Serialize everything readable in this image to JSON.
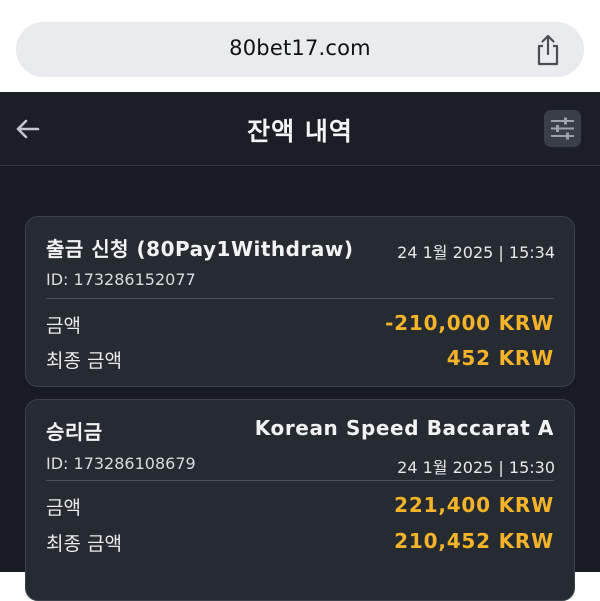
{
  "browser": {
    "url": "80bet17.com"
  },
  "header": {
    "title": "잔액 내역"
  },
  "transactions": [
    {
      "title": "출금 신청 (80Pay1Withdraw)",
      "game": "",
      "id_line": "ID: 173286152077",
      "datetime": "24 1월 2025 | 15:34",
      "amount_label": "금액",
      "amount": "-210,000 KRW",
      "final_label": "최종 금액",
      "final_amount": "452 KRW"
    },
    {
      "title": "승리금",
      "game": "Korean Speed Baccarat A",
      "id_line": "ID: 173286108679",
      "datetime": "24 1월 2025 | 15:30",
      "amount_label": "금액",
      "amount": "221,400 KRW",
      "final_label": "최종 금액",
      "final_amount": "210,452 KRW"
    }
  ],
  "colors": {
    "accent": "#f5b32a",
    "background": "#181b21",
    "card": "#262a31"
  },
  "icons": {
    "share": "share-icon",
    "back": "back-arrow-icon",
    "filter": "filter-sliders-icon"
  }
}
